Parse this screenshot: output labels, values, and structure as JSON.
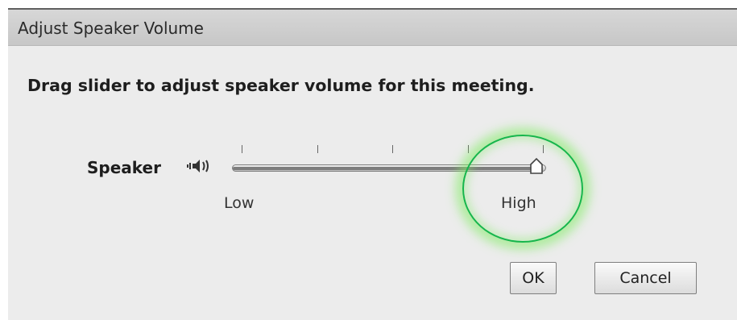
{
  "dialog": {
    "title": "Adjust Speaker Volume",
    "instruction": "Drag slider to adjust speaker volume for this meeting."
  },
  "speaker_control": {
    "label": "Speaker",
    "icon": "speaker-volume-icon",
    "slider": {
      "low_label": "Low",
      "high_label": "High",
      "value_fraction": 0.97,
      "tick_count": 5
    }
  },
  "buttons": {
    "ok_label": "OK",
    "cancel_label": "Cancel"
  },
  "colors": {
    "dialog_background": "#ececec",
    "titlebar_background": "#cfcfcf",
    "highlight_ring": "#16b64b"
  }
}
